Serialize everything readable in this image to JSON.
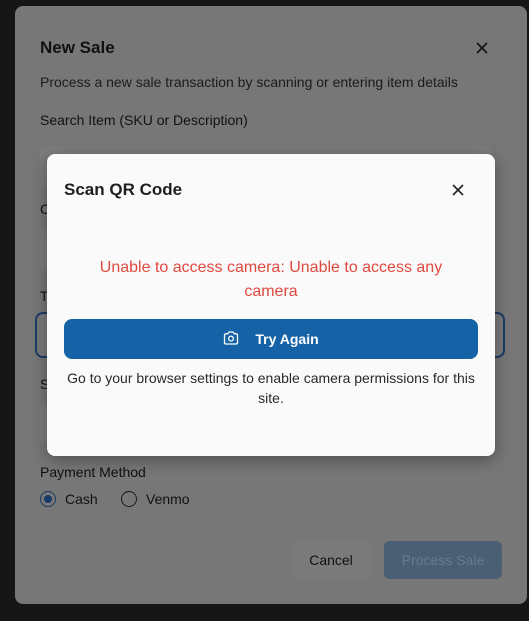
{
  "backdrop": {
    "close_icon": "close-icon"
  },
  "sale_dialog": {
    "title": "New Sale",
    "description": "Process a new sale transaction by scanning or entering item details",
    "search_label": "Search Item (SKU or Description)",
    "partial_labels": [
      "C",
      "T",
      "S"
    ],
    "payment": {
      "label": "Payment Method",
      "options": [
        {
          "label": "Cash",
          "selected": true
        },
        {
          "label": "Venmo",
          "selected": false
        }
      ]
    },
    "cancel_label": "Cancel",
    "process_label": "Process Sale"
  },
  "qr_dialog": {
    "title": "Scan QR Code",
    "error": "Unable to access camera: Unable to access any camera",
    "try_again_label": "Try Again",
    "help": "Go to your browser settings to enable camera permissions for this site.",
    "icons": {
      "close": "close-icon",
      "camera": "camera-icon"
    }
  },
  "colors": {
    "error": "#e0493e",
    "primary": "#1563a6",
    "dialog_bg": "#fafafa"
  }
}
